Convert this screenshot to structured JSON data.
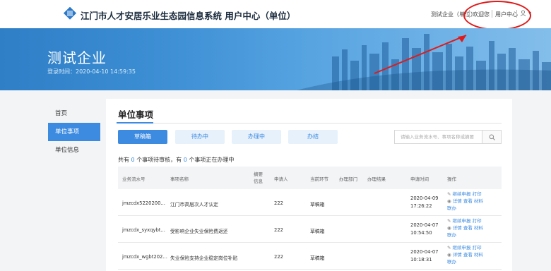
{
  "header": {
    "title": "江门市人才安居乐业生态园信息系统 用户中心（单位）",
    "nav": [
      "测试企业（单位）",
      "欢迎您",
      "用户中心"
    ],
    "user_icon": "user-icon",
    "caret": "▾"
  },
  "banner": {
    "company": "测试企业",
    "login_time": "登录时间：2020-04-10 14:59:35"
  },
  "sidebar": {
    "items": [
      {
        "label": "首页"
      },
      {
        "label": "单位事项"
      },
      {
        "label": "单位信息"
      }
    ],
    "active_index": 1
  },
  "main": {
    "title": "单位事项",
    "tabs": [
      {
        "label": "草稿箱"
      },
      {
        "label": "待办中"
      },
      {
        "label": "办理中"
      },
      {
        "label": "办结"
      }
    ],
    "search": {
      "placeholder": "请输入业务流水号、事项名称或摘要",
      "button_icon": "search-icon"
    },
    "summary": {
      "part1": "共有",
      "pending_count": "0",
      "part2": "个事项待审核，有",
      "processing_count": "0",
      "part3": "个事项正在办理中"
    },
    "table": {
      "headers": [
        "业务流水号",
        "事项名称",
        "摘要信息",
        "申请人",
        "当前环节",
        "办理部门",
        "办理结果",
        "申请时间",
        "操作"
      ],
      "rows": [
        {
          "serial": "jmzcdx5220200...",
          "name": "江门市高层次人才认定",
          "summary": "",
          "applicant": "222",
          "stage": "草稿箱",
          "dept": "",
          "result": "",
          "time": "2020-04-09 17:26:22",
          "ops": [
            "继续申报",
            "打印",
            "详情",
            "查看",
            "材料",
            "联办"
          ]
        },
        {
          "serial": "jmzcdx_syxqybt...",
          "name": "受影响企业失业保险费返还",
          "summary": "",
          "applicant": "222",
          "stage": "草稿箱",
          "dept": "",
          "result": "",
          "time": "2020-04-07 10:54:50",
          "ops": [
            "继续申报",
            "打印",
            "详情",
            "查看",
            "材料",
            "联办"
          ]
        },
        {
          "serial": "jmzcdx_wgbt202...",
          "name": "失业保险支持企业稳定岗位补贴",
          "summary": "",
          "applicant": "222",
          "stage": "草稿箱",
          "dept": "",
          "result": "",
          "time": "2020-04-07 10:18:31",
          "ops": [
            "继续申报",
            "打印",
            "详情",
            "查看",
            "材料",
            "联办"
          ]
        }
      ]
    }
  },
  "annotation": {
    "color": "#e01a1a"
  }
}
